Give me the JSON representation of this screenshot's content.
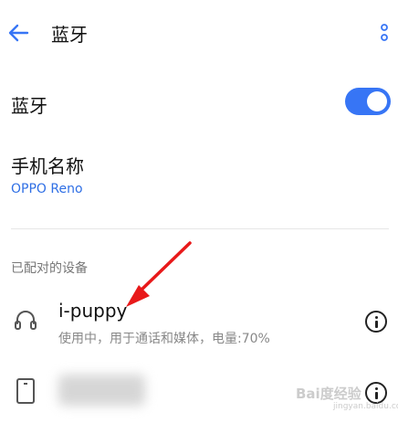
{
  "header": {
    "title": "蓝牙"
  },
  "bluetooth": {
    "label": "蓝牙",
    "enabled": true,
    "accent_color": "#3775f5"
  },
  "device_name": {
    "label": "手机名称",
    "value": "OPPO Reno"
  },
  "paired": {
    "section_title": "已配对的设备",
    "devices": [
      {
        "name": "i-puppy",
        "status": "使用中，用于通话和媒体，电量:70%",
        "icon": "headphones-icon"
      },
      {
        "name": "",
        "icon": "phone-icon",
        "blurred": true
      }
    ]
  },
  "watermark": {
    "text": "Bai度经验",
    "sub": "jingyan.baidu.com"
  }
}
